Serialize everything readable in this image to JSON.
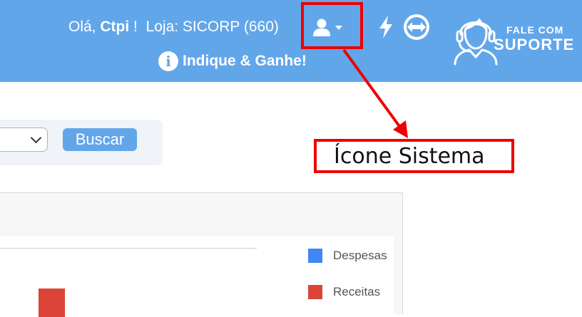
{
  "header": {
    "greeting_prefix": "Olá,",
    "user_name": "Ctpi",
    "greeting_suffix": "!",
    "store_label": "Loja: SICORP (660)",
    "indique_label": "Indique & Ganhe!",
    "support_line1": "FALE COM",
    "support_line2": "SUPORTE",
    "colors": {
      "header_bg": "#62a6ea",
      "text": "#ffffff"
    },
    "icons": [
      "user-icon",
      "caret-down-icon",
      "bolt-icon",
      "teamviewer-icon",
      "support-agent-icon",
      "info-icon"
    ]
  },
  "filter": {
    "search_button_label": "Buscar"
  },
  "chart_data": {
    "type": "bar",
    "series": [
      {
        "name": "Despesas",
        "color": "#4285f4"
      },
      {
        "name": "Receitas",
        "color": "#dc4437"
      }
    ]
  },
  "annotation": {
    "callout_text": "Ícone Sistema",
    "color": "#ee0000"
  }
}
